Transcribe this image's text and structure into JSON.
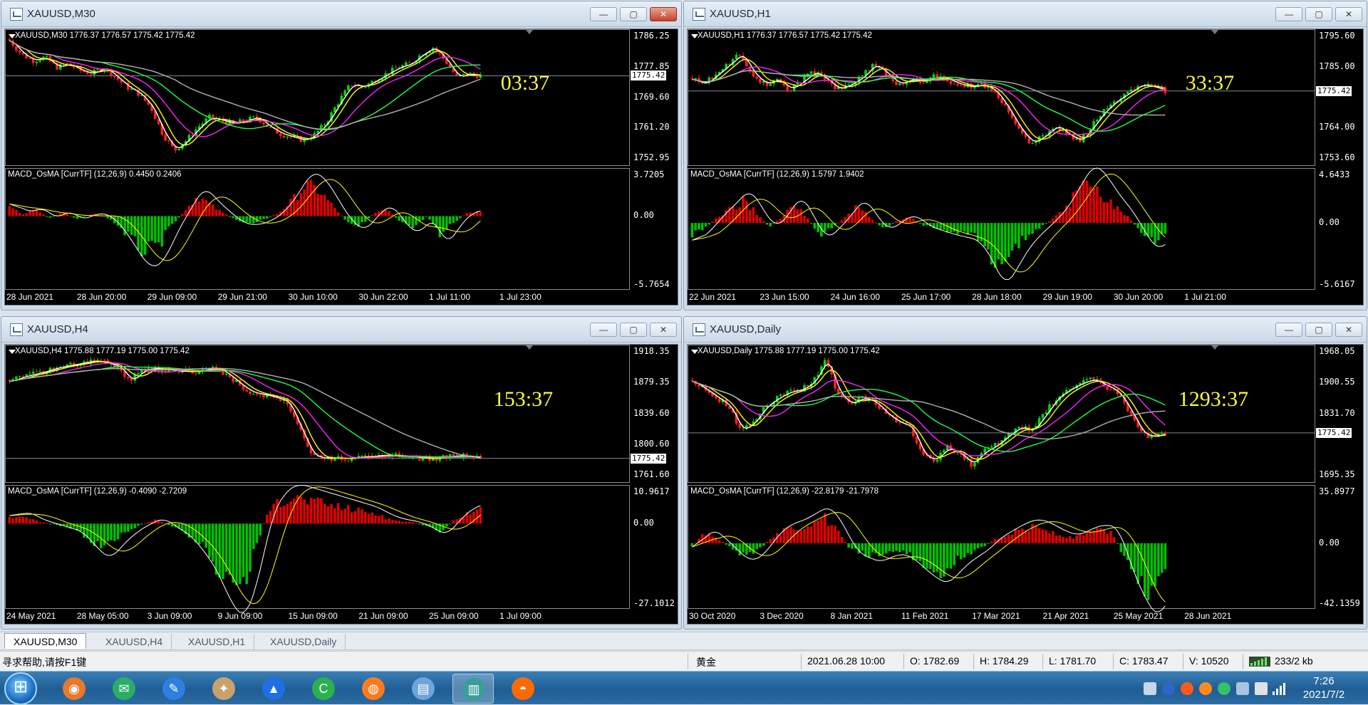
{
  "colors": {
    "bull": "#00d900",
    "bear": "#ff2020",
    "hist_pos": "#e00000",
    "hist_neg": "#00c000",
    "ma_yellow": "#ffff00",
    "ma_white": "#ffffff",
    "ma_magenta": "#ff20ff",
    "ma_green": "#20ff40",
    "ma_gray": "#b0b0b0",
    "countdown": "#fffa3c"
  },
  "icons": {
    "window_menu": "chart-window-icon",
    "minimize": "minimize-icon",
    "maximize": "maximize-icon",
    "close": "close-icon"
  },
  "windows": [
    {
      "id": "m30",
      "title": "XAUUSD,M30",
      "buttons": {
        "minimize": "—",
        "maximize": "▢",
        "close": "✕"
      },
      "header": "XAUUSD,M30  1776.37 1776.57 1775.42 1775.42",
      "macd_header": "MACD_OsMA [CurrTF] (12,26,9) 0.4450 0.2406",
      "countdown": "03:37",
      "current_price": "1775.42",
      "price_ticks": [
        "1786.25",
        "1777.85",
        "1769.60",
        "1761.20",
        "1752.95"
      ],
      "price_range": [
        1749,
        1789
      ],
      "macd_ticks": [
        "3.7205",
        "0.00",
        "-5.7654"
      ],
      "macd_range": [
        -6.6,
        4.3
      ],
      "time_ticks": [
        "28 Jun 2021",
        "28 Jun 20:00",
        "29 Jun 09:00",
        "29 Jun 21:00",
        "30 Jun 10:00",
        "30 Jun 22:00",
        "1 Jul 11:00",
        "1 Jul 23:00"
      ],
      "chart_data": {
        "type": "candlestick",
        "anchors_close": [
          1786,
          1782,
          1780,
          1781,
          1778,
          1779,
          1777,
          1776,
          1778,
          1775,
          1772,
          1770,
          1766,
          1758,
          1753,
          1756,
          1760,
          1763,
          1762,
          1761,
          1762,
          1763,
          1760,
          1758,
          1757,
          1756,
          1758,
          1762,
          1768,
          1773,
          1772,
          1774,
          1776,
          1778,
          1779,
          1782,
          1784,
          1780,
          1775,
          1776,
          1775.42
        ],
        "macd_hist_anchors": [
          0.8,
          0.2,
          0.6,
          -0.2,
          0.4,
          -0.3,
          0.2,
          0.1,
          -0.8,
          -2.2,
          -3.5,
          -3.0,
          -1.0,
          0.5,
          2.0,
          1.0,
          0.2,
          -0.5,
          -0.6,
          -0.3,
          0.3,
          1.5,
          3.0,
          2.5,
          1.0,
          -0.4,
          -1.0,
          0.2,
          0.8,
          -0.6,
          -1.2,
          0.0,
          -2.0,
          -0.6,
          0.3,
          0.4
        ]
      }
    },
    {
      "id": "h1",
      "title": "XAUUSD,H1",
      "buttons": {
        "minimize": "—",
        "maximize": "▢",
        "close": "✕"
      },
      "header": "XAUUSD,H1  1776.37 1776.57 1775.42 1775.42",
      "macd_header": "MACD_OsMA [CurrTF] (12,26,9) 1.5797 1.9402",
      "countdown": "33:37",
      "current_price": "1775.42",
      "price_ticks": [
        "1795.60",
        "1785.00",
        "1775.42",
        "1764.00",
        "1753.60"
      ],
      "price_range": [
        1747,
        1799
      ],
      "macd_ticks": [
        "4.6433",
        "0.00",
        "-5.6167"
      ],
      "macd_range": [
        -6.3,
        5.2
      ],
      "time_ticks": [
        "22 Jun 2021",
        "23 Jun 15:00",
        "24 Jun 16:00",
        "25 Jun 17:00",
        "28 Jun 18:00",
        "29 Jun 19:00",
        "30 Jun 20:00",
        "1 Jul 21:00"
      ],
      "chart_data": {
        "type": "candlestick",
        "anchors_close": [
          1780,
          1778,
          1782,
          1786,
          1790,
          1782,
          1778,
          1780,
          1776,
          1779,
          1783,
          1780,
          1776,
          1778,
          1781,
          1786,
          1782,
          1778,
          1780,
          1779,
          1781,
          1780,
          1778,
          1777,
          1778,
          1775,
          1768,
          1760,
          1755,
          1758,
          1762,
          1758,
          1756,
          1762,
          1768,
          1772,
          1775,
          1778,
          1777,
          1775.42
        ],
        "macd_hist_anchors": [
          -1.2,
          -0.5,
          0.6,
          1.4,
          2.4,
          1.0,
          -0.4,
          0.5,
          2.0,
          0.5,
          -1.2,
          -0.4,
          0.6,
          1.8,
          0.4,
          -0.6,
          0.2,
          0.6,
          -0.2,
          -0.5,
          -0.8,
          -1.0,
          -1.2,
          -2.6,
          -4.5,
          -3.0,
          -1.5,
          -0.6,
          0.2,
          1.2,
          2.8,
          4.2,
          3.2,
          1.8,
          0.8,
          -0.8,
          -2.0,
          -1.0
        ]
      }
    },
    {
      "id": "h4",
      "title": "XAUUSD,H4",
      "buttons": {
        "minimize": "—",
        "maximize": "▢",
        "close": "✕"
      },
      "header": "XAUUSD,H4  1775.88 1777.19 1775.00 1775.42",
      "macd_header": "MACD_OsMA [CurrTF] (12,26,9) -0.4090 -2.7209",
      "countdown": "153:37",
      "current_price": "1775.42",
      "price_ticks": [
        "1918.35",
        "1879.35",
        "1839.60",
        "1800.60",
        "1761.60"
      ],
      "price_range": [
        1745,
        1928
      ],
      "macd_ticks": [
        "10.9617",
        "0.00",
        "-27.1012"
      ],
      "macd_range": [
        -29,
        13
      ],
      "time_ticks": [
        "24 May 2021",
        "28 May 05:00",
        "3 Jun 09:00",
        "9 Jun 09:00",
        "15 Jun 09:00",
        "21 Jun 09:00",
        "25 Jun 09:00",
        "1 Jul 09:00"
      ],
      "chart_data": {
        "type": "candlestick",
        "anchors_close": [
          1880,
          1886,
          1890,
          1894,
          1899,
          1902,
          1905,
          1908,
          1905,
          1900,
          1880,
          1895,
          1898,
          1896,
          1894,
          1893,
          1895,
          1899,
          1890,
          1876,
          1865,
          1862,
          1858,
          1852,
          1815,
          1780,
          1775,
          1776,
          1775,
          1777,
          1778,
          1780,
          1779,
          1778,
          1776,
          1775,
          1777,
          1779,
          1778,
          1775.42
        ],
        "macd_hist_anchors": [
          2.0,
          3.0,
          1.0,
          0.0,
          -1.0,
          -2.0,
          -6.0,
          -9.0,
          -5.0,
          -2.0,
          0.0,
          1.5,
          -1.0,
          -3.0,
          -7.0,
          -12.0,
          -20.0,
          -24.0,
          -14.0,
          2.0,
          8.0,
          10.0,
          9.0,
          8.0,
          7.0,
          6.0,
          5.0,
          4.0,
          2.0,
          1.0,
          0.5,
          -1.0,
          -3.0,
          1.0,
          4.0,
          5.0
        ]
      }
    },
    {
      "id": "daily",
      "title": "XAUUSD,Daily",
      "buttons": {
        "minimize": "—",
        "maximize": "▢",
        "close": "✕"
      },
      "header": "XAUUSD,Daily  1775.88 1777.19 1775.00 1775.42",
      "macd_header": "MACD_OsMA [CurrTF] (12,26,9) -22.8179 -21.7978",
      "countdown": "1293:37",
      "current_price": "1775.42",
      "price_ticks": [
        "1968.05",
        "1900.55",
        "1831.70",
        "1775.42",
        "1695.35"
      ],
      "price_range": [
        1660,
        1985
      ],
      "macd_ticks": [
        "35.8977",
        "0.00",
        "-42.1359"
      ],
      "macd_range": [
        -47,
        42
      ],
      "time_ticks": [
        "30 Oct 2020",
        "3 Dec 2020",
        "8 Jan 2021",
        "11 Feb 2021",
        "17 Mar 2021",
        "21 Apr 2021",
        "25 May 2021",
        "28 Jun 2021"
      ],
      "chart_data": {
        "type": "candlestick",
        "anchors_close": [
          1900,
          1880,
          1860,
          1840,
          1780,
          1800,
          1840,
          1860,
          1875,
          1880,
          1900,
          1955,
          1870,
          1845,
          1860,
          1850,
          1820,
          1800,
          1790,
          1720,
          1710,
          1740,
          1725,
          1700,
          1730,
          1745,
          1770,
          1790,
          1780,
          1820,
          1860,
          1880,
          1895,
          1905,
          1890,
          1875,
          1830,
          1775,
          1765,
          1775.42
        ],
        "macd_hist_anchors": [
          -2,
          8,
          3,
          -4,
          -10,
          -6,
          4,
          10,
          12,
          16,
          20,
          10,
          -4,
          -8,
          -10,
          -6,
          -6,
          -12,
          -18,
          -22,
          -14,
          -8,
          -4,
          3,
          7,
          11,
          13,
          10,
          6,
          4,
          8,
          10,
          8,
          -14,
          -30,
          -40,
          -26
        ]
      }
    }
  ],
  "tabs": [
    "XAUUSD,M30",
    "XAUUSD,H4",
    "XAUUSD,H1",
    "XAUUSD,Daily"
  ],
  "status": {
    "help": "寻求帮助,请按F1键",
    "profile": "黄金",
    "datetime": "2021.06.28 10:00",
    "open": "O: 1782.69",
    "high": "H: 1784.29",
    "low": "L: 1781.70",
    "close": "C: 1783.47",
    "volume": "V: 10520",
    "traffic": "233/2 kb"
  },
  "taskbar": {
    "apps": [
      {
        "name": "app-firefox-alt",
        "color": "#e8782a",
        "glyph": "◉"
      },
      {
        "name": "app-wechat",
        "color": "#2aae67",
        "glyph": "✉"
      },
      {
        "name": "app-edit",
        "color": "#2d7fe0",
        "glyph": "✎"
      },
      {
        "name": "app-paint",
        "color": "#c9a26b",
        "glyph": "✦"
      },
      {
        "name": "app-tencent-meeting",
        "color": "#1f6fe5",
        "glyph": "▲"
      },
      {
        "name": "app-green-c",
        "color": "#2bb14c",
        "glyph": "C"
      },
      {
        "name": "app-firefox",
        "color": "#ff7b1c",
        "glyph": "◍"
      },
      {
        "name": "app-notepad",
        "color": "#6fa4d8",
        "glyph": "▤"
      },
      {
        "name": "app-metatrader",
        "color": "#3b9c9c",
        "glyph": "▥"
      },
      {
        "name": "app-fox-face",
        "color": "#ff6a00",
        "glyph": "◓"
      }
    ],
    "clock_time": "7:26",
    "clock_date": "2021/7/2"
  }
}
